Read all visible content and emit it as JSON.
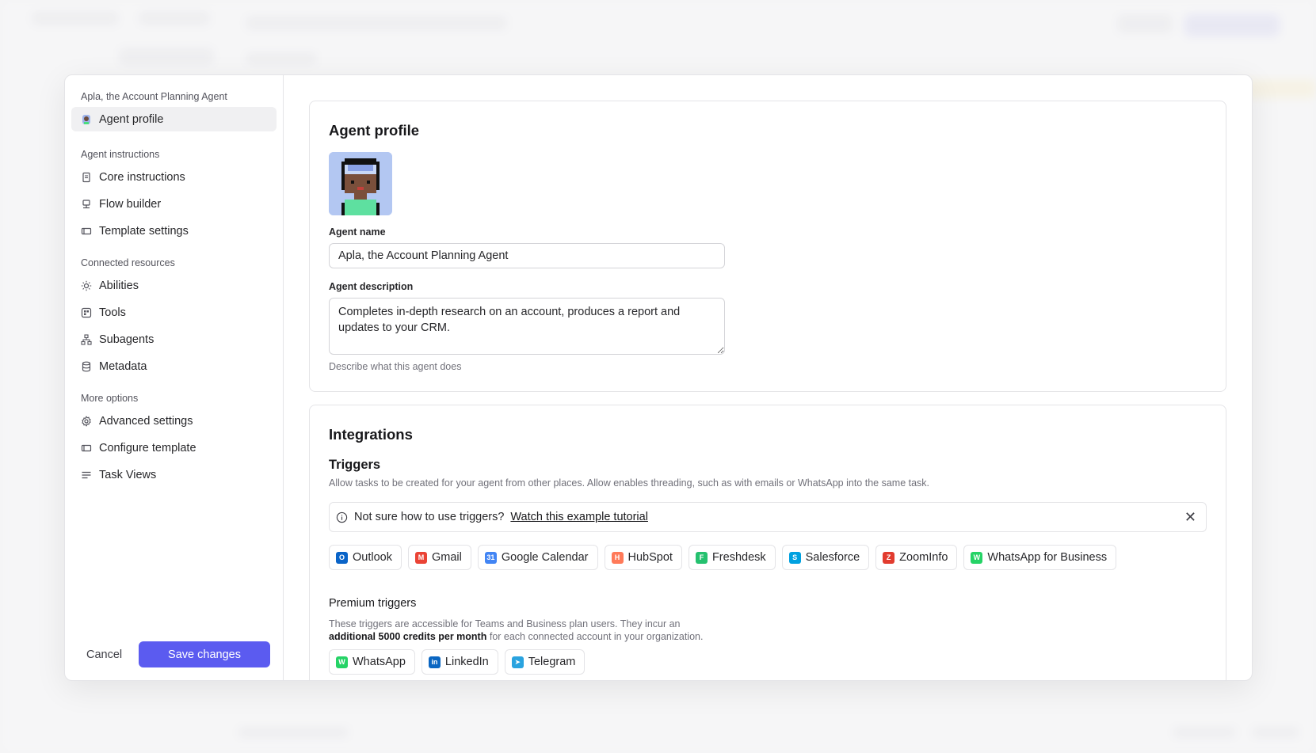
{
  "sidebar": {
    "agent_title": "Apla, the Account Planning Agent",
    "profile_item": "Agent profile",
    "groups": [
      {
        "title": "Agent instructions",
        "items": [
          "Core instructions",
          "Flow builder",
          "Template settings"
        ]
      },
      {
        "title": "Connected resources",
        "items": [
          "Abilities",
          "Tools",
          "Subagents",
          "Metadata"
        ]
      },
      {
        "title": "More options",
        "items": [
          "Advanced settings",
          "Configure template",
          "Task Views"
        ]
      }
    ],
    "cancel_label": "Cancel",
    "save_label": "Save changes"
  },
  "profile": {
    "title": "Agent profile",
    "name_label": "Agent name",
    "name_value": "Apla, the Account Planning Agent",
    "description_label": "Agent description",
    "description_value": "Completes in-depth research on an account, produces a report and updates to your CRM.",
    "description_hint": "Describe what this agent does"
  },
  "integrations": {
    "title": "Integrations",
    "triggers_title": "Triggers",
    "triggers_desc": "Allow tasks to be created for your agent from other places. Allow enables threading, such as with emails or WhatsApp into the same task.",
    "notice_text": "Not sure how to use triggers?",
    "notice_link": "Watch this example tutorial",
    "trigger_chips": [
      {
        "label": "Outlook",
        "color": "#0a64c8",
        "glyph": "O"
      },
      {
        "label": "Gmail",
        "color": "#ea4335",
        "glyph": "M"
      },
      {
        "label": "Google Calendar",
        "color": "#4285f4",
        "glyph": "31"
      },
      {
        "label": "HubSpot",
        "color": "#ff7a59",
        "glyph": "H"
      },
      {
        "label": "Freshdesk",
        "color": "#25c16f",
        "glyph": "F"
      },
      {
        "label": "Salesforce",
        "color": "#00a1e0",
        "glyph": "S"
      },
      {
        "label": "ZoomInfo",
        "color": "#e23c2f",
        "glyph": "Z"
      },
      {
        "label": "WhatsApp for Business",
        "color": "#25d366",
        "glyph": "W"
      }
    ],
    "premium_title": "Premium triggers",
    "premium_desc_1": "These triggers are accessible for Teams and Business plan users. They incur an",
    "premium_desc_bold": "additional 5000 credits per month",
    "premium_desc_2": "for each connected account in your organization.",
    "premium_chips": [
      {
        "label": "WhatsApp",
        "color": "#25d366",
        "glyph": "W"
      },
      {
        "label": "LinkedIn",
        "color": "#0a66c2",
        "glyph": "in"
      },
      {
        "label": "Telegram",
        "color": "#2aa3df",
        "glyph": "➤"
      }
    ]
  },
  "icons": {
    "groups": [
      [
        "document-icon",
        "flow-icon",
        "template-icon"
      ],
      [
        "sun-icon",
        "tools-icon",
        "hierarchy-icon",
        "database-icon"
      ],
      [
        "gear-icon",
        "template-icon",
        "list-icon"
      ]
    ]
  }
}
